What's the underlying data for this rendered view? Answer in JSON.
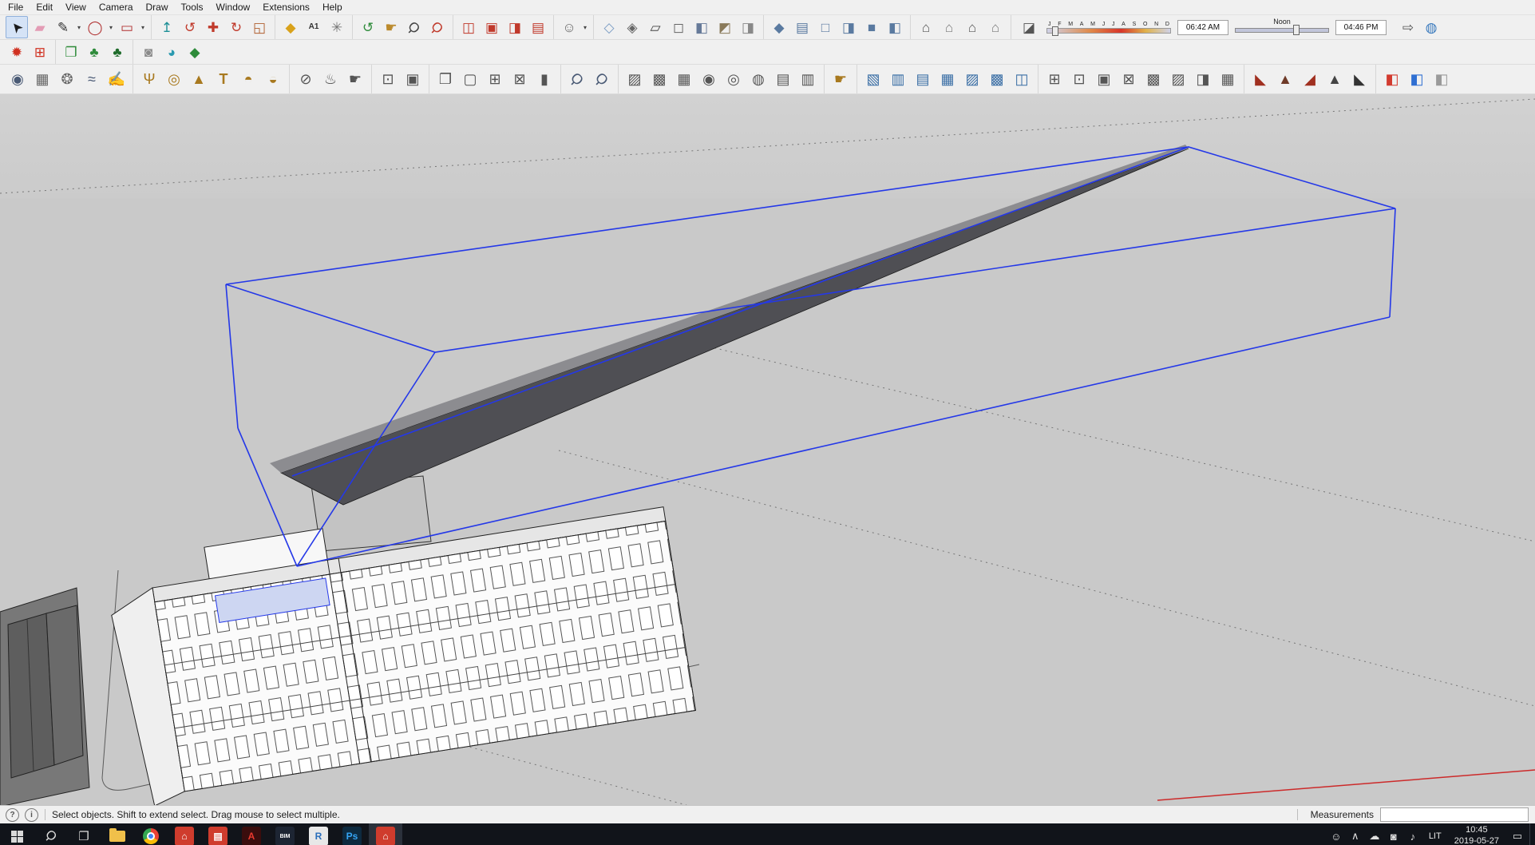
{
  "colors": {
    "selection_blue": "#2438e8",
    "viewport_gray": "#c9c9c9",
    "toolbar_bg": "#f0f0f0",
    "taskbar_dark": "#11141a",
    "sketchup_red": "#cf3c2d",
    "axis_red": "#cc2a2a"
  },
  "menubar": {
    "items": [
      "File",
      "Edit",
      "View",
      "Camera",
      "Draw",
      "Tools",
      "Window",
      "Extensions",
      "Help"
    ]
  },
  "toolbars": {
    "tb1_left": [
      [
        {
          "name": "select-tool",
          "glyph": "➤",
          "color": "#1b1b1b",
          "rot": -130,
          "active": true
        },
        {
          "name": "eraser-tool",
          "glyph": "▰",
          "color": "#e39cb5"
        },
        {
          "name": "line-tool",
          "glyph": "✎",
          "color": "#333",
          "dd": true
        },
        {
          "name": "arc-tool",
          "glyph": "◯",
          "color": "#b03030",
          "dd": true
        },
        {
          "name": "rectangle-tool",
          "glyph": "▭",
          "color": "#b03030",
          "dd": true
        }
      ],
      [
        {
          "name": "push-pull-tool",
          "glyph": "↥",
          "color": "#1d8f96"
        },
        {
          "name": "follow-me-tool",
          "glyph": "↺",
          "color": "#c03a2b"
        },
        {
          "name": "move-tool",
          "glyph": "✚",
          "color": "#c03a2b"
        },
        {
          "name": "rotate-tool",
          "glyph": "↻",
          "color": "#c03a2b"
        },
        {
          "name": "scale-tool",
          "glyph": "◱",
          "color": "#b06030"
        }
      ],
      [
        {
          "name": "paint-bucket-tool",
          "glyph": "◆",
          "color": "#d9a21b"
        },
        {
          "name": "text-tool",
          "glyph": "A1",
          "color": "#333",
          "text": true
        },
        {
          "name": "axes-tool",
          "glyph": "✳",
          "color": "#777"
        }
      ],
      [
        {
          "name": "orbit-tool",
          "glyph": "↺",
          "color": "#2e8b3a"
        },
        {
          "name": "pan-tool",
          "glyph": "☛",
          "color": "#bb8a2c"
        },
        {
          "name": "zoom-tool",
          "glyph": "Ϙ",
          "color": "#444",
          "rot": 45
        },
        {
          "name": "zoom-extents-tool",
          "glyph": "Ϙ",
          "color": "#c03a2b",
          "rot": 45
        }
      ],
      [
        {
          "name": "position-camera-tool",
          "glyph": "◫",
          "color": "#c0392b"
        },
        {
          "name": "look-around-tool",
          "glyph": "▣",
          "color": "#c0392b"
        },
        {
          "name": "walk-tool",
          "glyph": "◨",
          "color": "#c0392b"
        },
        {
          "name": "image-tool",
          "glyph": "▤",
          "color": "#c0392b"
        }
      ],
      [
        {
          "name": "person-tool",
          "glyph": "☺",
          "color": "#666",
          "dd": true
        }
      ],
      [
        {
          "name": "x-ray-style",
          "glyph": "◇",
          "color": "#7a9cc4"
        },
        {
          "name": "back-edges-style",
          "glyph": "◈",
          "color": "#666"
        },
        {
          "name": "wireframe-style",
          "glyph": "▱",
          "color": "#444"
        },
        {
          "name": "hidden-line-style",
          "glyph": "◻",
          "color": "#666"
        },
        {
          "name": "shaded-style",
          "glyph": "◧",
          "color": "#667a99"
        },
        {
          "name": "shaded-textures-style",
          "glyph": "◩",
          "color": "#8a7a5a"
        },
        {
          "name": "monochrome-style",
          "glyph": "◨",
          "color": "#888"
        }
      ],
      [
        {
          "name": "iso-view",
          "glyph": "◆",
          "color": "#5a7aa0"
        },
        {
          "name": "top-view",
          "glyph": "▤",
          "color": "#5a7aa0"
        },
        {
          "name": "front-view",
          "glyph": "□",
          "color": "#5a7aa0"
        },
        {
          "name": "right-view",
          "glyph": "◨",
          "color": "#5a7aa0"
        },
        {
          "name": "back-view",
          "glyph": "■",
          "color": "#5a7aa0"
        },
        {
          "name": "left-view",
          "glyph": "◧",
          "color": "#5a7aa0"
        }
      ],
      [
        {
          "name": "3d-warehouse-button",
          "glyph": "⌂",
          "color": "#555"
        },
        {
          "name": "share-model-button",
          "glyph": "⌂",
          "color": "#7a7a7a"
        },
        {
          "name": "extension-warehouse-button",
          "glyph": "⌂",
          "color": "#555"
        },
        {
          "name": "model-library-button",
          "glyph": "⌂",
          "color": "#7a7a7a"
        }
      ]
    ],
    "tb1_right": [
      [
        {
          "name": "send-to-layout-button",
          "glyph": "⇨",
          "color": "#555"
        },
        {
          "name": "globe-tool",
          "glyph": "◍",
          "color": "#3a7abd"
        }
      ]
    ],
    "tb2": [
      [
        {
          "name": "sun-plugin-tool",
          "glyph": "✹",
          "color": "#d03020"
        },
        {
          "name": "grid-plugin-tool",
          "glyph": "⊞",
          "color": "#d03020"
        }
      ],
      [
        {
          "name": "tree-window-tool",
          "glyph": "❐",
          "color": "#2e8b3a"
        },
        {
          "name": "tree-tool",
          "glyph": "♣",
          "color": "#2e8b3a"
        },
        {
          "name": "forest-tool",
          "glyph": "♣",
          "color": "#1e6b2a"
        }
      ],
      [
        {
          "name": "shield-tool",
          "glyph": "◙",
          "color": "#8a8a8a"
        },
        {
          "name": "droplet-tool",
          "glyph": "◕",
          "color": "#2a9ab0"
        },
        {
          "name": "gem-tool",
          "glyph": "◆",
          "color": "#2e8b3a"
        }
      ]
    ],
    "tb3": [
      [
        {
          "name": "projector-tool",
          "glyph": "◉",
          "color": "#4a5a75"
        },
        {
          "name": "fog-tool",
          "glyph": "▦",
          "color": "#666"
        },
        {
          "name": "burst-tool",
          "glyph": "❂",
          "color": "#666"
        },
        {
          "name": "wave-tool",
          "glyph": "≈",
          "color": "#4a5a75"
        },
        {
          "name": "sketch-hand-tool",
          "glyph": "✍",
          "color": "#666"
        }
      ],
      [
        {
          "name": "wineglass-tool",
          "glyph": "Ψ",
          "color": "#a8791f"
        },
        {
          "name": "donut-tool",
          "glyph": "◎",
          "color": "#a8791f"
        },
        {
          "name": "cone-tool",
          "glyph": "▲",
          "color": "#a8791f"
        },
        {
          "name": "pin-tool",
          "glyph": "T",
          "color": "#a8791f",
          "text": true
        },
        {
          "name": "dome-tool",
          "glyph": "◓",
          "color": "#a8791f"
        },
        {
          "name": "shell-tool",
          "glyph": "◒",
          "color": "#a8791f"
        }
      ],
      [
        {
          "name": "null-tool",
          "glyph": "⊘",
          "color": "#555"
        },
        {
          "name": "teapot-tool",
          "glyph": "♨",
          "color": "#555"
        },
        {
          "name": "grab-teapot-tool",
          "glyph": "☛",
          "color": "#555"
        }
      ],
      [
        {
          "name": "stage-tool",
          "glyph": "⊡",
          "color": "#555"
        },
        {
          "name": "screen-tool",
          "glyph": "▣",
          "color": "#555"
        }
      ],
      [
        {
          "name": "window-maximize-tool",
          "glyph": "❐",
          "color": "#555"
        },
        {
          "name": "window-frame-tool",
          "glyph": "▢",
          "color": "#555"
        },
        {
          "name": "window-grid-tool",
          "glyph": "⊞",
          "color": "#555"
        },
        {
          "name": "window-close-tool",
          "glyph": "⊠",
          "color": "#555"
        },
        {
          "name": "lock-tool",
          "glyph": "▮",
          "color": "#555"
        }
      ],
      [
        {
          "name": "zoom-photo-tool",
          "glyph": "Ϙ",
          "color": "#4a5a75",
          "rot": 45
        },
        {
          "name": "zoom-component-tool",
          "glyph": "Ϙ",
          "color": "#4a5a75",
          "rot": 45
        }
      ],
      [
        {
          "name": "hatch-tool",
          "glyph": "▨",
          "color": "#555"
        },
        {
          "name": "mesh-cube-tool",
          "glyph": "▩",
          "color": "#555"
        },
        {
          "name": "checker-cube-tool",
          "glyph": "▦",
          "color": "#555"
        },
        {
          "name": "sphere-check-tool",
          "glyph": "◉",
          "color": "#555"
        },
        {
          "name": "target-sphere-tool",
          "glyph": "◎",
          "color": "#555"
        },
        {
          "name": "pattern-sphere-tool",
          "glyph": "◍",
          "color": "#555"
        },
        {
          "name": "dot-grid-tool",
          "glyph": "▤",
          "color": "#555"
        },
        {
          "name": "weave-tool",
          "glyph": "▥",
          "color": "#555"
        }
      ],
      [
        {
          "name": "select-hand-tool",
          "glyph": "☛",
          "color": "#a8791f"
        }
      ],
      [
        {
          "name": "component-stack-tool",
          "glyph": "▧",
          "color": "#3a6ea5"
        },
        {
          "name": "component-edit-tool",
          "glyph": "▥",
          "color": "#3a6ea5"
        },
        {
          "name": "component-array-tool",
          "glyph": "▤",
          "color": "#3a6ea5"
        },
        {
          "name": "component-grid-tool",
          "glyph": "▦",
          "color": "#3a6ea5"
        },
        {
          "name": "component-swap-tool",
          "glyph": "▨",
          "color": "#3a6ea5"
        },
        {
          "name": "component-merge-tool",
          "glyph": "▩",
          "color": "#3a6ea5"
        },
        {
          "name": "component-split-tool",
          "glyph": "◫",
          "color": "#3a6ea5"
        }
      ],
      [
        {
          "name": "quad-mesh-tool",
          "glyph": "⊞",
          "color": "#555"
        },
        {
          "name": "subdivide-tool",
          "glyph": "⊡",
          "color": "#555"
        },
        {
          "name": "crease-tool",
          "glyph": "▣",
          "color": "#555"
        },
        {
          "name": "uv-map-tool",
          "glyph": "⊠",
          "color": "#555"
        },
        {
          "name": "bake-texture-tool",
          "glyph": "▩",
          "color": "#555"
        },
        {
          "name": "proxy-tool",
          "glyph": "▨",
          "color": "#555"
        },
        {
          "name": "wrap-tool",
          "glyph": "◨",
          "color": "#555"
        },
        {
          "name": "relax-tool",
          "glyph": "▦",
          "color": "#555"
        }
      ],
      [
        {
          "name": "roof-texture-tool",
          "glyph": "◣",
          "color": "#a03020"
        },
        {
          "name": "terrain-texture-tool",
          "glyph": "▲",
          "color": "#6e3a28"
        },
        {
          "name": "slope-tool",
          "glyph": "◢",
          "color": "#a03020"
        },
        {
          "name": "cliff-tool",
          "glyph": "▲",
          "color": "#444"
        },
        {
          "name": "ridge-tool",
          "glyph": "◣",
          "color": "#333"
        }
      ],
      [
        {
          "name": "red-cube-tool",
          "glyph": "◧",
          "color": "#d23b2f"
        },
        {
          "name": "blue-cube-tool",
          "glyph": "◧",
          "color": "#2f6fd2"
        },
        {
          "name": "white-cube-tool",
          "glyph": "◧",
          "color": "#9a9a9a"
        }
      ]
    ]
  },
  "shadow": {
    "toggle_glyph": "◪",
    "months": [
      "J",
      "F",
      "M",
      "A",
      "M",
      "J",
      "J",
      "A",
      "S",
      "O",
      "N",
      "D"
    ],
    "start_time": "06:42 AM",
    "noon_label": "Noon",
    "end_time": "04:46 PM"
  },
  "statusbar": {
    "help_glyph": "?",
    "info_glyph": "i",
    "message": "Select objects. Shift to extend select. Drag mouse to select multiple.",
    "measurements_label": "Measurements",
    "measurements_value": ""
  },
  "taskbar": {
    "apps": [
      {
        "name": "taskbar-start-button",
        "special": "start"
      },
      {
        "name": "taskbar-search-button",
        "special": "search",
        "glyph": "Ϙ"
      },
      {
        "name": "taskbar-taskview-button",
        "special": "taskview",
        "glyph": "❐"
      },
      {
        "name": "taskbar-file-explorer",
        "special": "folder"
      },
      {
        "name": "taskbar-chrome",
        "special": "chrome"
      },
      {
        "name": "taskbar-sketchup",
        "label": "⌂",
        "bg": "#cf3c2d",
        "fg": "#ffffff"
      },
      {
        "name": "taskbar-layout",
        "label": "▤",
        "bg": "#cf3c2d",
        "fg": "#ffffff"
      },
      {
        "name": "taskbar-acrobat",
        "label": "A",
        "bg": "#3a0d0d",
        "fg": "#e8392e"
      },
      {
        "name": "taskbar-bimsight",
        "label": "BIM",
        "bg": "#1d2533",
        "fg": "#ffffff",
        "small": true
      },
      {
        "name": "taskbar-revit",
        "label": "R",
        "bg": "#e8e8e8",
        "fg": "#2a6ebb"
      },
      {
        "name": "taskbar-photoshop",
        "label": "Ps",
        "bg": "#0d2a3f",
        "fg": "#35a4f3"
      },
      {
        "name": "taskbar-sketchup-active",
        "label": "⌂",
        "bg": "#cf3c2d",
        "fg": "#ffffff",
        "active": true
      }
    ],
    "tray_icons": [
      {
        "name": "tray-people-icon",
        "glyph": "☺"
      },
      {
        "name": "tray-chevron-icon",
        "glyph": "∧"
      },
      {
        "name": "tray-cloud-icon",
        "glyph": "☁"
      },
      {
        "name": "tray-alert-icon",
        "glyph": "◙"
      },
      {
        "name": "tray-volume-icon",
        "glyph": "♪"
      }
    ],
    "language": "LIT",
    "time": "10:45",
    "date": "2019-05-27"
  }
}
